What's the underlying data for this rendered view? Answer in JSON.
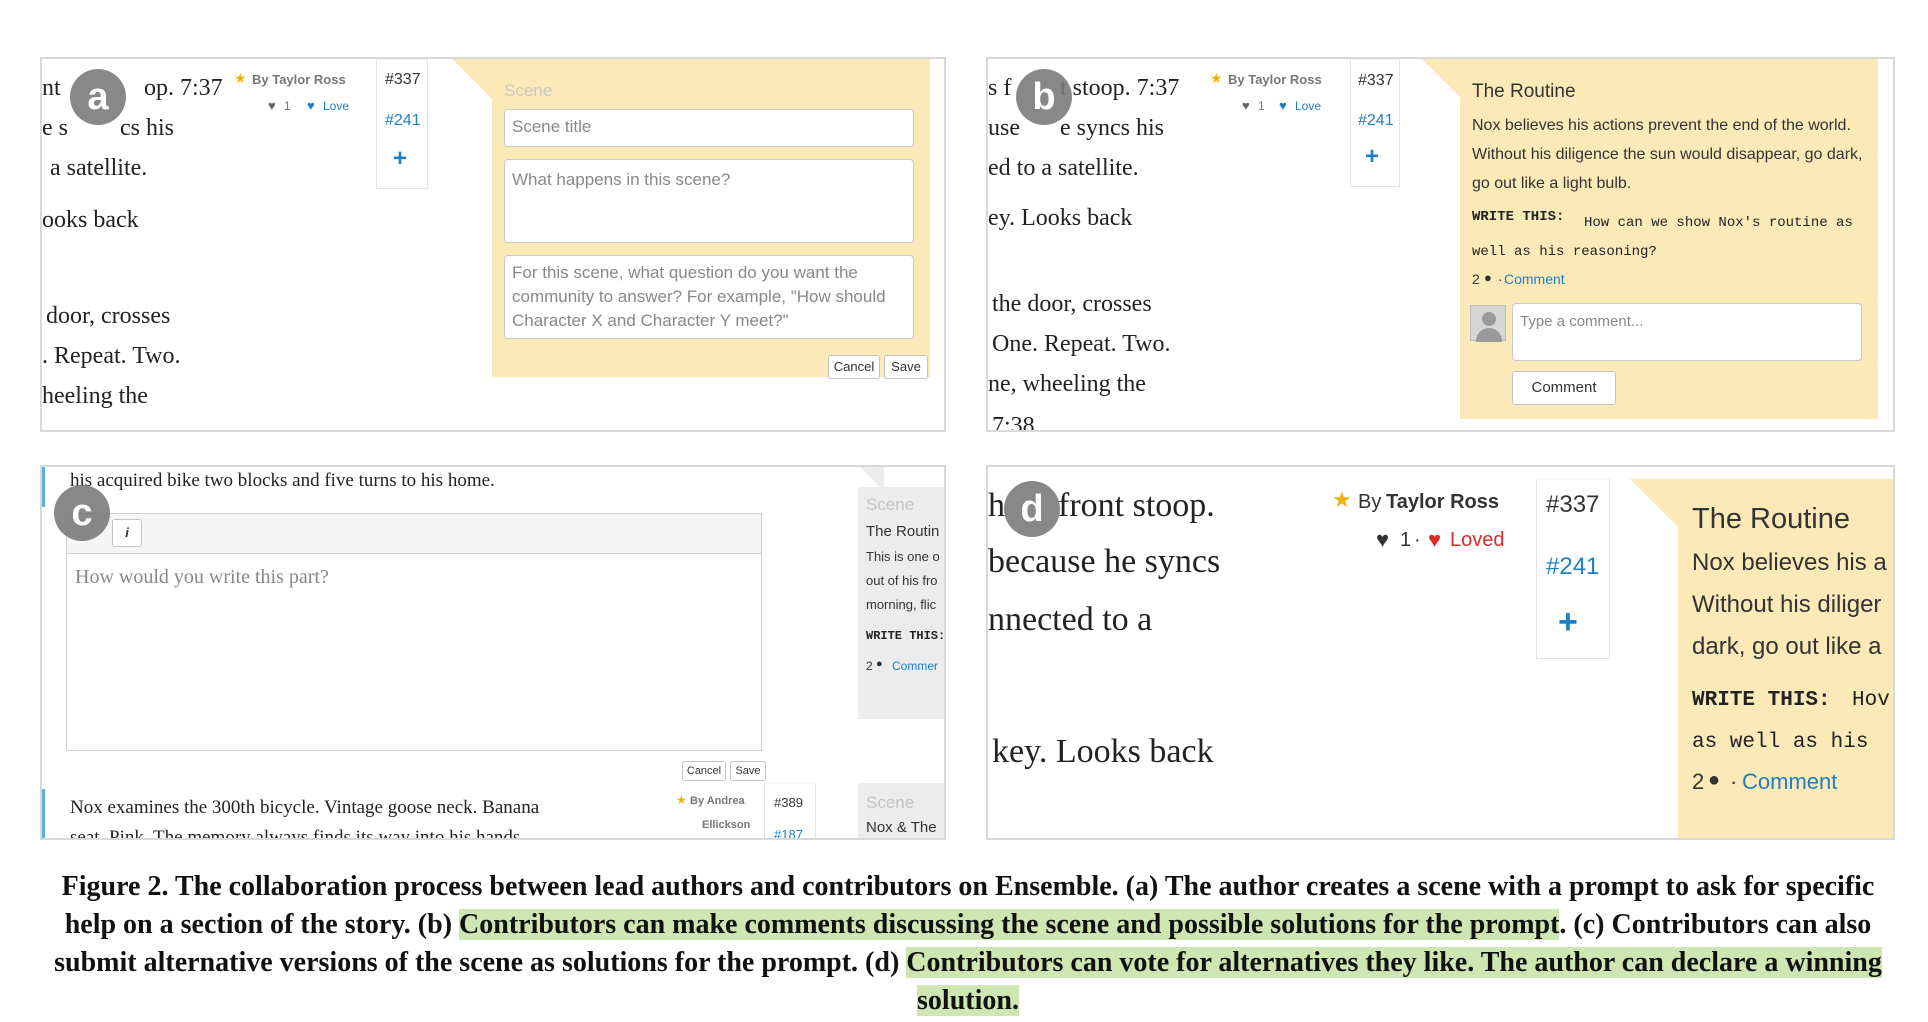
{
  "panel_a": {
    "label": "a",
    "story": [
      "nt",
      "op. 7:37",
      "e s",
      "cs his",
      "a satellite.",
      "ooks back",
      "door, crosses",
      ". Repeat. Two.",
      "heeling the"
    ],
    "author": "By Taylor Ross",
    "votes": "1",
    "love": "Love",
    "nums": [
      "#337",
      "#241"
    ],
    "plus": "+",
    "form": {
      "header": "Scene",
      "title_placeholder": "Scene title",
      "happens_placeholder": "What happens in this scene?",
      "question_placeholder": "For this scene, what question do you want the community to answer? For example, \"How should Character X and Character Y meet?\"",
      "cancel": "Cancel",
      "save": "Save"
    }
  },
  "panel_b": {
    "label": "b",
    "story": [
      "s f",
      "t stoop. 7:37",
      "use",
      "e syncs his",
      "ed to a satellite.",
      "ey. Looks back",
      "the door, crosses",
      "One. Repeat. Two.",
      "ne, wheeling the",
      "7:38."
    ],
    "author": "By Taylor Ross",
    "votes": "1",
    "love": "Love",
    "nums": [
      "#337",
      "#241"
    ],
    "plus": "+",
    "card": {
      "title": "The Routine",
      "body": "Nox believes his actions prevent the end of the world. Without his diligence the sun would disappear, go dark, go out like a light bulb.",
      "write_label": "WRITE THIS:",
      "write_text": "How can we show Nox's routine as well as his reasoning?",
      "comments": "2",
      "comment_link": "Comment",
      "comment_placeholder": "Type a comment...",
      "comment_button": "Comment"
    }
  },
  "panel_c": {
    "label": "c",
    "top_line": "his acquired bike two blocks and five turns to his home.",
    "toolbar_italic": "i",
    "editor_placeholder": "How would you write this part?",
    "cancel": "Cancel",
    "save": "Save",
    "side_card": {
      "header": "Scene",
      "title": "The Routin",
      "lines": [
        "This is one o",
        "out of his fro",
        "morning, flic"
      ],
      "write_label": "WRITE THIS:",
      "comments": "2",
      "comment_link": "Commer"
    },
    "next_story": [
      "Nox examines the 300th bicycle. Vintage goose neck. Banana",
      "seat. Pink. The memory always finds its way into his hands."
    ],
    "next_author": "By Andrea",
    "next_author2": "Ellickson",
    "next_nums": [
      "#389",
      "#187"
    ],
    "next_card": {
      "header": "Scene",
      "title": "Nox & The"
    }
  },
  "panel_d": {
    "label": "d",
    "story": [
      "h",
      "front stoop.",
      "because he syncs",
      "nnected to a",
      "key. Looks back"
    ],
    "author_prefix": "By",
    "author_name": "Taylor Ross",
    "votes": "1",
    "loved": "Loved",
    "nums": [
      "#337",
      "#241"
    ],
    "plus": "+",
    "card": {
      "title": "The Routine",
      "lines": [
        "Nox believes his a",
        "Without his diliger",
        "dark, go out like a"
      ],
      "write_label": "WRITE THIS:",
      "write_lines": [
        "Hov",
        "as well as his"
      ],
      "comments": "2",
      "comment_link": "Comment"
    }
  },
  "caption": {
    "part1": "Figure 2. The collaboration process between lead authors and contributors on Ensemble. (a) The author creates a scene with a prompt to ask for specific help on a section of the story. (b) ",
    "hl1": "Contributors can make comments discussing the scene and possible solutions for the prompt",
    "part2": ". (c) Contributors can also submit alternative versions of the scene as solutions for the prompt. (d) ",
    "hl2": "Contributors can vote for alternatives they like. The author can declare a winning solution."
  },
  "colors": {
    "card": "#fbe9b8",
    "link": "#1f7fc4",
    "love_red": "#e02a2a",
    "highlight": "#cde6b2"
  }
}
